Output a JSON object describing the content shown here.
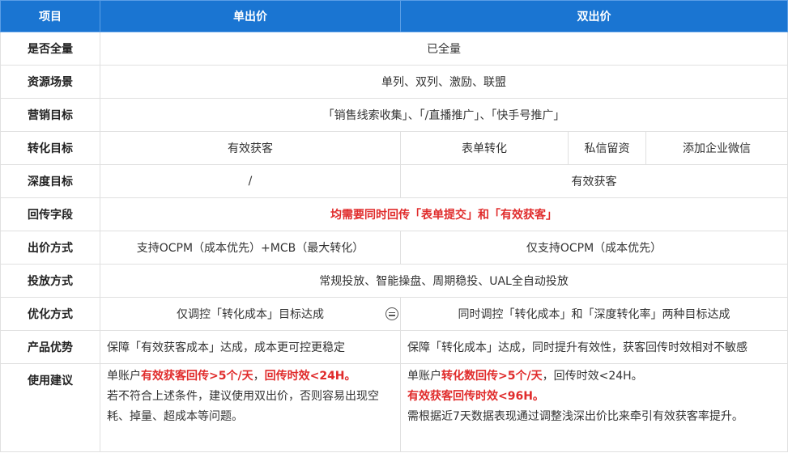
{
  "header": {
    "item": "项目",
    "single": "单出价",
    "double": "双出价"
  },
  "rows": {
    "full_volume": {
      "label": "是否全量",
      "value": "已全量"
    },
    "scene": {
      "label": "资源场景",
      "value": "单列、双列、激励、联盟"
    },
    "marketing": {
      "label": "营销目标",
      "value": "「销售线索收集」、「/直播推广」、「快手号推广」"
    },
    "conversion": {
      "label": "转化目标",
      "single": "有效获客",
      "form": "表单转化",
      "private": "私信留资",
      "wechat": "添加企业微信"
    },
    "depth": {
      "label": "深度目标",
      "single": "/",
      "double": "有效获客"
    },
    "callback": {
      "label": "回传字段",
      "value": "均需要同时回传「表单提交」和「有效获客」"
    },
    "bidding": {
      "label": "出价方式",
      "single": "支持OCPM（成本优先）+MCB（最大转化）",
      "double": "仅支持OCPM（成本优先）"
    },
    "delivery": {
      "label": "投放方式",
      "value": "常规投放、智能操盘、周期稳投、UAL全自动投放"
    },
    "optimize": {
      "label": "优化方式",
      "single": "仅调控「转化成本」目标达成",
      "double": "同时调控「转化成本」和「深度转化率」两种目标达成"
    },
    "advantage": {
      "label": "产品优势",
      "single": "保障「有效获客成本」达成，成本更可控更稳定",
      "double": "保障「转化成本」达成，同时提升有效性，获客回传时效相对不敏感"
    },
    "suggestion": {
      "label": "使用建议",
      "single": {
        "p1_prefix": "单账户",
        "p1_red1": "有效获客回传>5个/天",
        "p1_sep": "，",
        "p1_red2": "回传时效<24H。",
        "p2": "若不符合上述条件，建议使用双出价，否则容易出现空耗、掉量、超成本等问题。"
      },
      "double": {
        "p1_prefix": "单账户",
        "p1_red1": "转化数回传>5个/天",
        "p1_rest": "，回传时效<24H。",
        "p2_red": "有效获客回传时效<96H。",
        "p3": "需根据近7天数据表现通过调整浅深出价比来牵引有效获客率提升。"
      }
    }
  },
  "icons": {
    "optimize_toggle": "equals-circle-icon"
  },
  "colors": {
    "header_bg": "#1a75d2",
    "highlight": "#e02b2b",
    "border": "#e0e0e0"
  }
}
